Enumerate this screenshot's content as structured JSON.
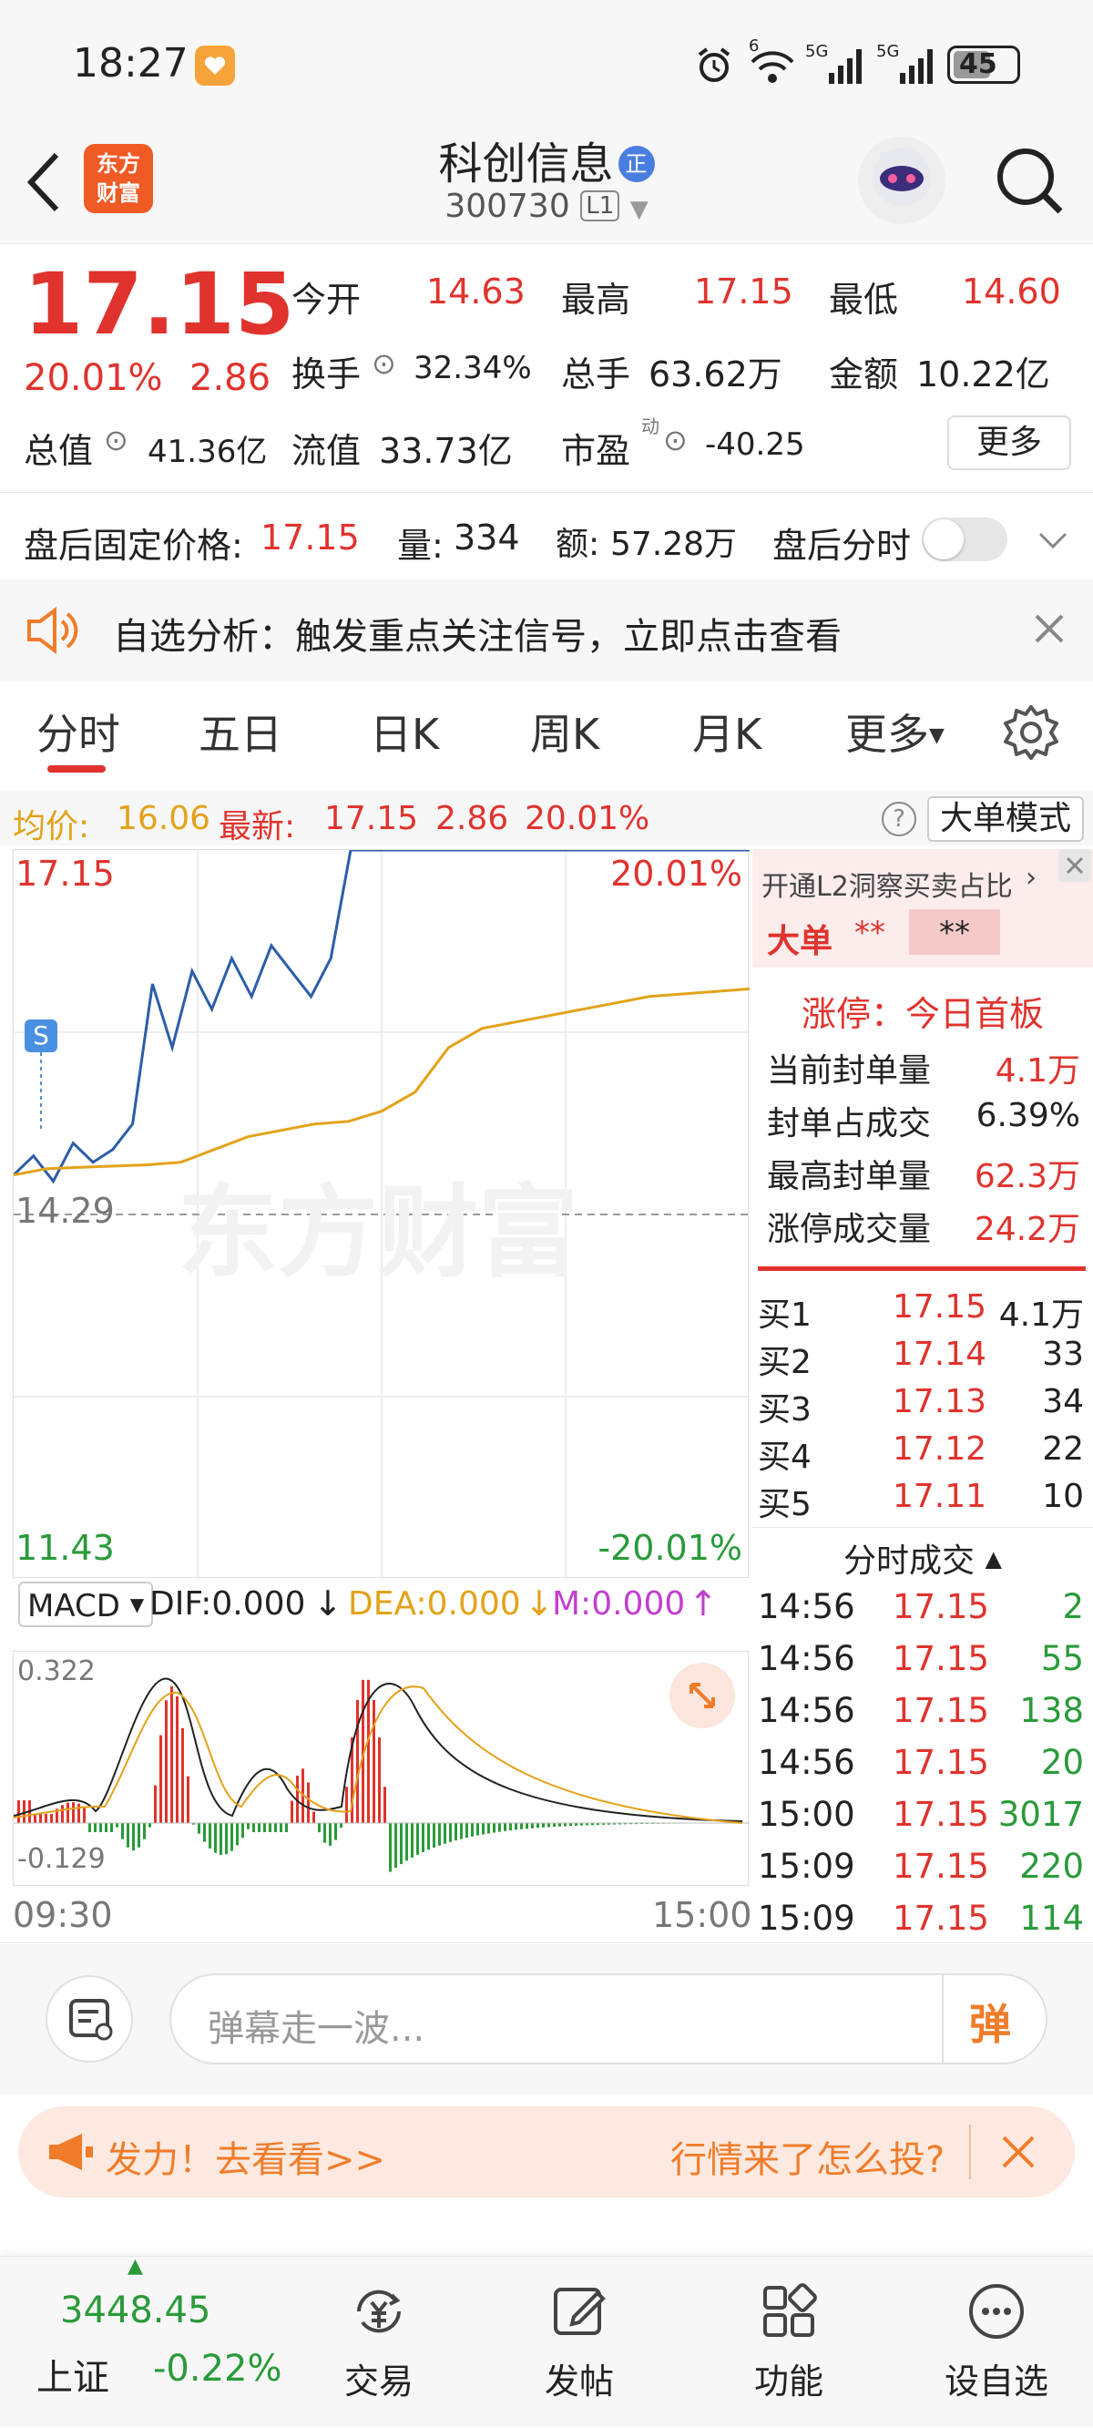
{
  "status": {
    "time": "18:27",
    "net1": "6",
    "net2": "5G",
    "net3": "5G",
    "battery": "45"
  },
  "header": {
    "app_logo_line1": "东方",
    "app_logo_line2": "财富",
    "stock_name": "科创信息",
    "stock_badge": "正",
    "stock_code": "300730",
    "level": "L1"
  },
  "quote": {
    "price": "17.15",
    "change_pct": "20.01%",
    "change": "2.86",
    "open_label": "今开",
    "open": "14.63",
    "high_label": "最高",
    "high": "17.15",
    "low_label": "最低",
    "low": "14.60",
    "turnover_label": "换手",
    "turnover": "32.34%",
    "volume_label": "总手",
    "volume": "63.62万",
    "amount_label": "金额",
    "amount": "10.22亿",
    "mktcap_label": "总值",
    "mktcap": "41.36亿",
    "float_label": "流值",
    "float_cap": "33.73亿",
    "pe_label": "市盈",
    "pe_sup": "动",
    "pe": "-40.25",
    "more": "更多"
  },
  "after_hours": {
    "price_label": "盘后固定价格:",
    "price": "17.15",
    "vol_label": "量:",
    "vol": "334",
    "amt_label": "额:",
    "amt": "57.28万",
    "chart_label": "盘后分时"
  },
  "banner": {
    "text": "自选分析：触发重点关注信号，立即点击查看"
  },
  "tabs": [
    "分时",
    "五日",
    "日K",
    "周K",
    "月K",
    "更多"
  ],
  "chart_info": {
    "avg_label": "均价:",
    "avg": "16.06",
    "latest_label": "最新:",
    "latest": "17.15",
    "chg": "2.86",
    "chg_pct": "20.01%",
    "mode_button": "大单模式",
    "y_top": "17.15",
    "y_top_pct": "20.01%",
    "y_mid": "14.29",
    "y_bot": "11.43",
    "y_bot_pct": "-20.01%",
    "signal": "S",
    "watermark": "东方财富",
    "time_start": "09:30",
    "time_end": "15:00"
  },
  "chart_data": {
    "type": "line",
    "x_range": [
      "09:30",
      "15:00"
    ],
    "ylim": [
      11.43,
      17.15
    ],
    "series": [
      {
        "values": [
          14.6,
          14.75,
          14.55,
          14.85,
          14.7,
          14.8,
          15.0,
          16.1,
          15.6,
          16.2,
          15.9,
          16.3,
          16.0,
          16.4,
          16.2,
          16.0,
          16.3,
          17.15,
          17.15,
          17.15,
          17.15,
          17.15,
          17.15
        ]
      },
      {
        "values": [
          14.6,
          14.65,
          14.66,
          14.67,
          14.68,
          14.7,
          14.8,
          14.9,
          14.95,
          15.0,
          15.02,
          15.1,
          15.25,
          15.6,
          15.75,
          15.8,
          15.85,
          15.9,
          15.95,
          16.0,
          16.02,
          16.04,
          16.06
        ]
      }
    ]
  },
  "macd": {
    "label": "MACD",
    "dif": "DIF:0.000",
    "dea": "DEA:0.000",
    "m": "M:0.000",
    "top": "0.322",
    "bottom": "-0.129"
  },
  "l2": {
    "title": "开通L2洞察买卖占比",
    "big_order_label": "大单",
    "big_order_val1": "**",
    "big_order_val2": "**",
    "limit_title": "涨停：今日首板",
    "rows": [
      {
        "label": "当前封单量",
        "value": "4.1万"
      },
      {
        "label": "封单占成交",
        "value": "6.39%"
      },
      {
        "label": "最高封单量",
        "value": "62.3万"
      },
      {
        "label": "涨停成交量",
        "value": "24.2万"
      }
    ]
  },
  "order_book": [
    {
      "label": "买1",
      "price": "17.15",
      "qty": "4.1万"
    },
    {
      "label": "买2",
      "price": "17.14",
      "qty": "33"
    },
    {
      "label": "买3",
      "price": "17.13",
      "qty": "34"
    },
    {
      "label": "买4",
      "price": "17.12",
      "qty": "22"
    },
    {
      "label": "买5",
      "price": "17.11",
      "qty": "10"
    }
  ],
  "deals": {
    "title": "分时成交",
    "rows": [
      {
        "time": "14:56",
        "price": "17.15",
        "qty": "2"
      },
      {
        "time": "14:56",
        "price": "17.15",
        "qty": "55"
      },
      {
        "time": "14:56",
        "price": "17.15",
        "qty": "138"
      },
      {
        "time": "14:56",
        "price": "17.15",
        "qty": "20"
      },
      {
        "time": "15:00",
        "price": "17.15",
        "qty": "3017"
      },
      {
        "time": "15:09",
        "price": "17.15",
        "qty": "220"
      },
      {
        "time": "15:09",
        "price": "17.15",
        "qty": "114"
      }
    ]
  },
  "comment": {
    "placeholder": "弹幕走一波...",
    "send": "弹"
  },
  "promo": {
    "left": "发力！去看看>>",
    "right": "行情来了怎么投?"
  },
  "bottom_nav": {
    "index_value": "3448.45",
    "index_name": "上证",
    "index_change": "-0.22%",
    "items": [
      "交易",
      "发帖",
      "功能",
      "设自选"
    ]
  },
  "colors": {
    "up": "#e0332d",
    "down": "#2a9a3a",
    "avg_line": "#e3a21a",
    "price_line": "#2b5da8",
    "accent": "#f07c2a"
  }
}
